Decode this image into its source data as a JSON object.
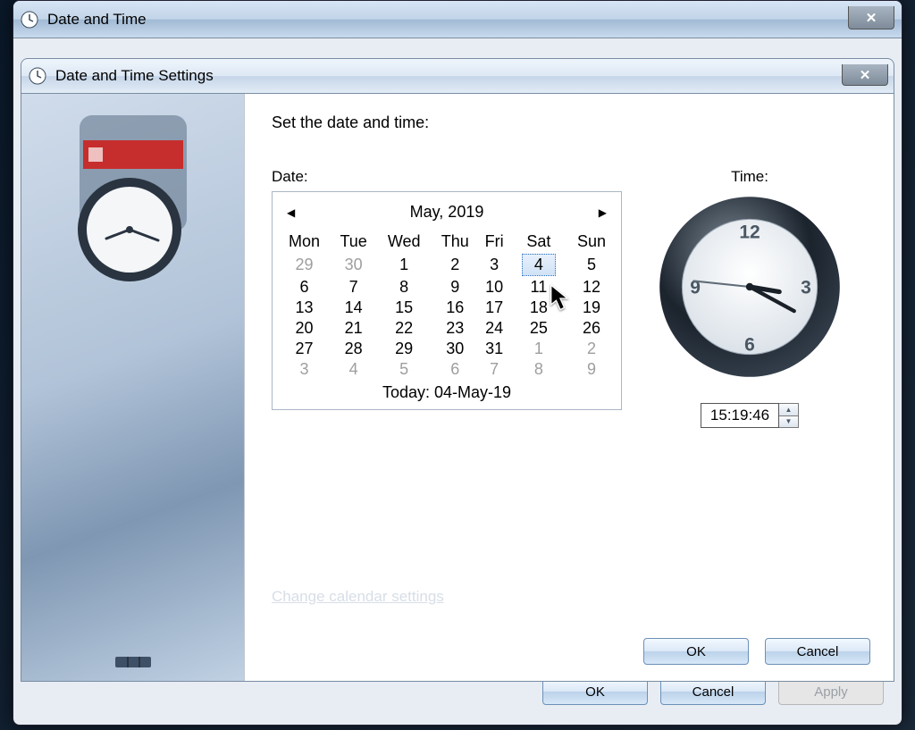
{
  "outer": {
    "title": "Date and Time",
    "buttons": {
      "ok": "OK",
      "cancel": "Cancel",
      "apply": "Apply"
    }
  },
  "inner": {
    "title": "Date and Time Settings",
    "heading": "Set the date and time:",
    "date_label": "Date:",
    "time_label": "Time:",
    "link": "Change calendar settings",
    "buttons": {
      "ok": "OK",
      "cancel": "Cancel"
    }
  },
  "calendar": {
    "month_label": "May, 2019",
    "weekdays": [
      "Mon",
      "Tue",
      "Wed",
      "Thu",
      "Fri",
      "Sat",
      "Sun"
    ],
    "weeks": [
      [
        {
          "d": 29,
          "other": true
        },
        {
          "d": 30,
          "other": true
        },
        {
          "d": 1
        },
        {
          "d": 2
        },
        {
          "d": 3
        },
        {
          "d": 4,
          "sel": true
        },
        {
          "d": 5
        }
      ],
      [
        {
          "d": 6
        },
        {
          "d": 7
        },
        {
          "d": 8
        },
        {
          "d": 9
        },
        {
          "d": 10
        },
        {
          "d": 11
        },
        {
          "d": 12
        }
      ],
      [
        {
          "d": 13
        },
        {
          "d": 14
        },
        {
          "d": 15
        },
        {
          "d": 16
        },
        {
          "d": 17
        },
        {
          "d": 18
        },
        {
          "d": 19
        }
      ],
      [
        {
          "d": 20
        },
        {
          "d": 21
        },
        {
          "d": 22
        },
        {
          "d": 23
        },
        {
          "d": 24
        },
        {
          "d": 25
        },
        {
          "d": 26
        }
      ],
      [
        {
          "d": 27
        },
        {
          "d": 28
        },
        {
          "d": 29
        },
        {
          "d": 30
        },
        {
          "d": 31
        },
        {
          "d": 1,
          "other": true
        },
        {
          "d": 2,
          "other": true
        }
      ],
      [
        {
          "d": 3,
          "other": true
        },
        {
          "d": 4,
          "other": true
        },
        {
          "d": 5,
          "other": true
        },
        {
          "d": 6,
          "other": true
        },
        {
          "d": 7,
          "other": true
        },
        {
          "d": 8,
          "other": true
        },
        {
          "d": 9,
          "other": true
        }
      ]
    ],
    "today_label": "Today: 04-May-19"
  },
  "time": {
    "value": "15:19:46",
    "hours": 15,
    "minutes": 19,
    "seconds": 46
  }
}
